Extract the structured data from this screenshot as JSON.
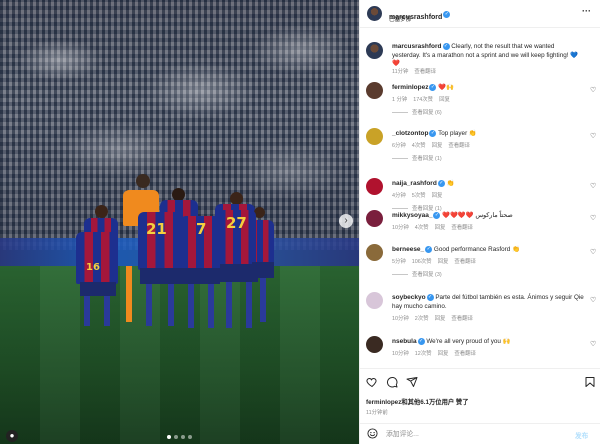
{
  "post": {
    "author": "marcusrashford",
    "location": "巴塞罗那"
  },
  "caption": {
    "username": "marcusrashford",
    "text": "Clearly, not the result that we wanted yesterday. It's a marathon not a sprint and we will keep fighting! 💙❤️",
    "time": "11分钟",
    "translate": "查看翻译"
  },
  "comments": [
    {
      "username": "ferminlopez",
      "text": "❤️🙌",
      "time": "1 分钟",
      "likes": "174次赞",
      "reply": "回复",
      "translate": "",
      "replies": "查看回复 (6)",
      "avatar_color": "#5a3b2e"
    },
    {
      "username": "_clotzontop",
      "text": "Top player 👏",
      "time": "6分钟",
      "likes": "4次赞",
      "reply": "回复",
      "translate": "查看翻译",
      "replies": "查看回复 (1)",
      "avatar_color": "#c9a227"
    },
    {
      "username": "naija_rashford",
      "text": "👏",
      "time": "4分钟",
      "likes": "5次赞",
      "reply": "回复",
      "translate": "",
      "replies": "查看回复 (1)",
      "avatar_color": "#b0122e"
    },
    {
      "username": "mikkysoyaa_",
      "text": "❤️❤️❤️❤️ صحتاً ماركوس",
      "time": "10分钟",
      "likes": "4次赞",
      "reply": "回复",
      "translate": "查看翻译",
      "replies": "",
      "avatar_color": "#7a1f3d"
    },
    {
      "username": "berneese_",
      "text": "Good performance Rasford 👏",
      "time": "5分钟",
      "likes": "106次赞",
      "reply": "回复",
      "translate": "查看翻译",
      "replies": "查看回复 (3)",
      "avatar_color": "#8a6a3a"
    },
    {
      "username": "soybeckyo",
      "text": "Parte del fútbol también es esta. Ánimos y seguir Qie hay mucho camino.",
      "time": "10分钟",
      "likes": "2次赞",
      "reply": "回复",
      "translate": "查看翻译",
      "replies": "",
      "avatar_color": "#d8c6d9"
    },
    {
      "username": "nsebula",
      "text": "We're all very proud of you 🙌",
      "time": "10分钟",
      "likes": "12次赞",
      "reply": "回复",
      "translate": "查看翻译",
      "replies": "",
      "avatar_color": "#3a2a22"
    }
  ],
  "likes_text": "ferminlopez和其他6.1万位用户 赞了",
  "post_time": "11分钟前",
  "composer": {
    "placeholder": "添加评论...",
    "post_label": "发布"
  },
  "colors": {
    "verified": "#3897f0",
    "muted": "#8e8e8e",
    "post_button": "#b2dffc"
  },
  "icons": [
    "heart-icon",
    "comment-icon",
    "share-icon",
    "bookmark-icon",
    "more-icon",
    "emoji-icon",
    "verified-icon"
  ]
}
